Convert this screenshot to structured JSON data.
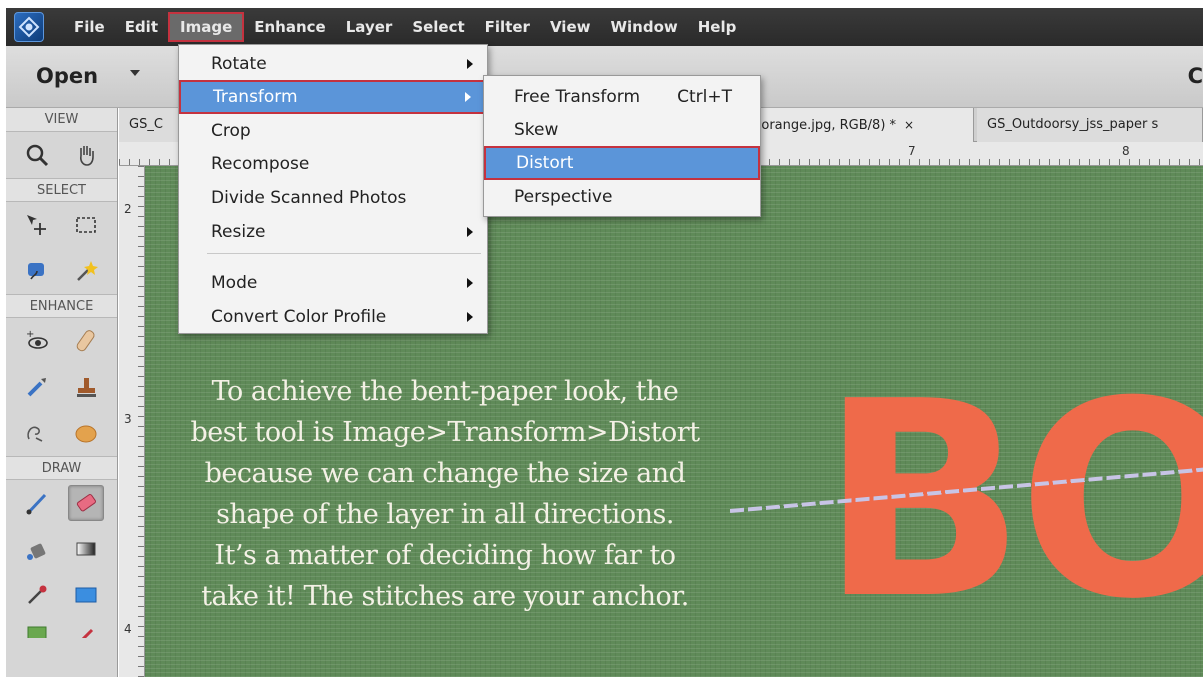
{
  "menubar": {
    "items": [
      "File",
      "Edit",
      "Image",
      "Enhance",
      "Layer",
      "Select",
      "Filter",
      "View",
      "Window",
      "Help"
    ],
    "active": "Image"
  },
  "optionsbar": {
    "open_label": "Open",
    "right_partial": "C"
  },
  "toolbox": {
    "sections": {
      "view": "VIEW",
      "select": "SELECT",
      "enhance": "ENHANCE",
      "draw": "DRAW"
    }
  },
  "tabs": {
    "tab1": "GS_C",
    "tab2": "d orange.jpg, RGB/8) *",
    "tab2_close": "×",
    "tab3": "GS_Outdoorsy_jss_paper s"
  },
  "rulers": {
    "h": [
      "7",
      "8"
    ],
    "v": [
      "2",
      "3",
      "4"
    ]
  },
  "image_menu": {
    "items": [
      "Rotate",
      "Transform",
      "Crop",
      "Recompose",
      "Divide Scanned Photos",
      "Resize",
      "Mode",
      "Convert Color Profile"
    ],
    "highlighted": "Transform"
  },
  "transform_submenu": {
    "items": [
      "Free Transform",
      "Skew",
      "Distort",
      "Perspective"
    ],
    "free_transform_shortcut": "Ctrl+T",
    "highlighted": "Distort"
  },
  "canvas": {
    "caption_lines": [
      "To achieve the bent-paper look, the",
      "best tool is Image>Transform>Distort",
      "because we can change the size and",
      "shape of the layer in all directions.",
      "It’s a matter of deciding how far to",
      "take it! The stitches are your anchor."
    ],
    "big_letters": "BO",
    "paper_color": "#5f8a58",
    "letter_color": "#ef6a4a"
  }
}
